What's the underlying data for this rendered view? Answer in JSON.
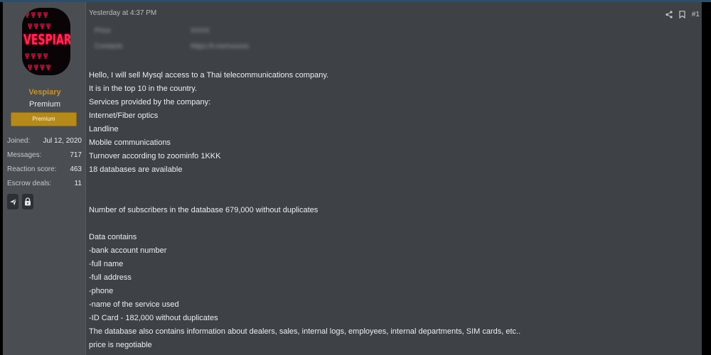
{
  "user": {
    "avatar_text": "VESPIAR",
    "username": "Vespiary",
    "title": "Premium",
    "badge": "Premium",
    "stats": [
      {
        "label": "Joined:",
        "value": "Jul 12, 2020"
      },
      {
        "label": "Messages:",
        "value": "717"
      },
      {
        "label": "Reaction score:",
        "value": "463"
      },
      {
        "label": "Escrow deals:",
        "value": "11"
      }
    ],
    "icons": [
      "telegram-icon",
      "lock-icon"
    ]
  },
  "post": {
    "timestamp": "Yesterday at 4:37 PM",
    "number": "#1",
    "hidden_fields": [
      {
        "label": "Price",
        "value": "XXXX"
      },
      {
        "label": "Contacts",
        "value": "https://t.me/xxxxxx"
      }
    ],
    "lines": [
      "Hello, I will sell Mysql access to a Thai telecommunications company.",
      "It is in the top 10 in the country.",
      "Services provided by the company:",
      "Internet/Fiber optics",
      "Landline",
      "Mobile communications",
      "Turnover according to zoominfo 1KKK",
      "18 databases are available",
      "",
      "",
      "Number of subscribers in the database 679,000 without duplicates",
      "",
      "Data contains",
      "-bank account number",
      "-full name",
      "-full address",
      "-phone",
      "-name of the service used",
      "-ID Card - 182,000 without duplicates",
      "The database also contains information about dealers, sales, internal logs, employees, internal departments, SIM cards, etc..",
      "price is negotiable"
    ]
  },
  "colors": {
    "background": "#3e4246",
    "sidebar": "#4a4e53",
    "username": "#c7932a",
    "badge": "#b58a1b"
  }
}
